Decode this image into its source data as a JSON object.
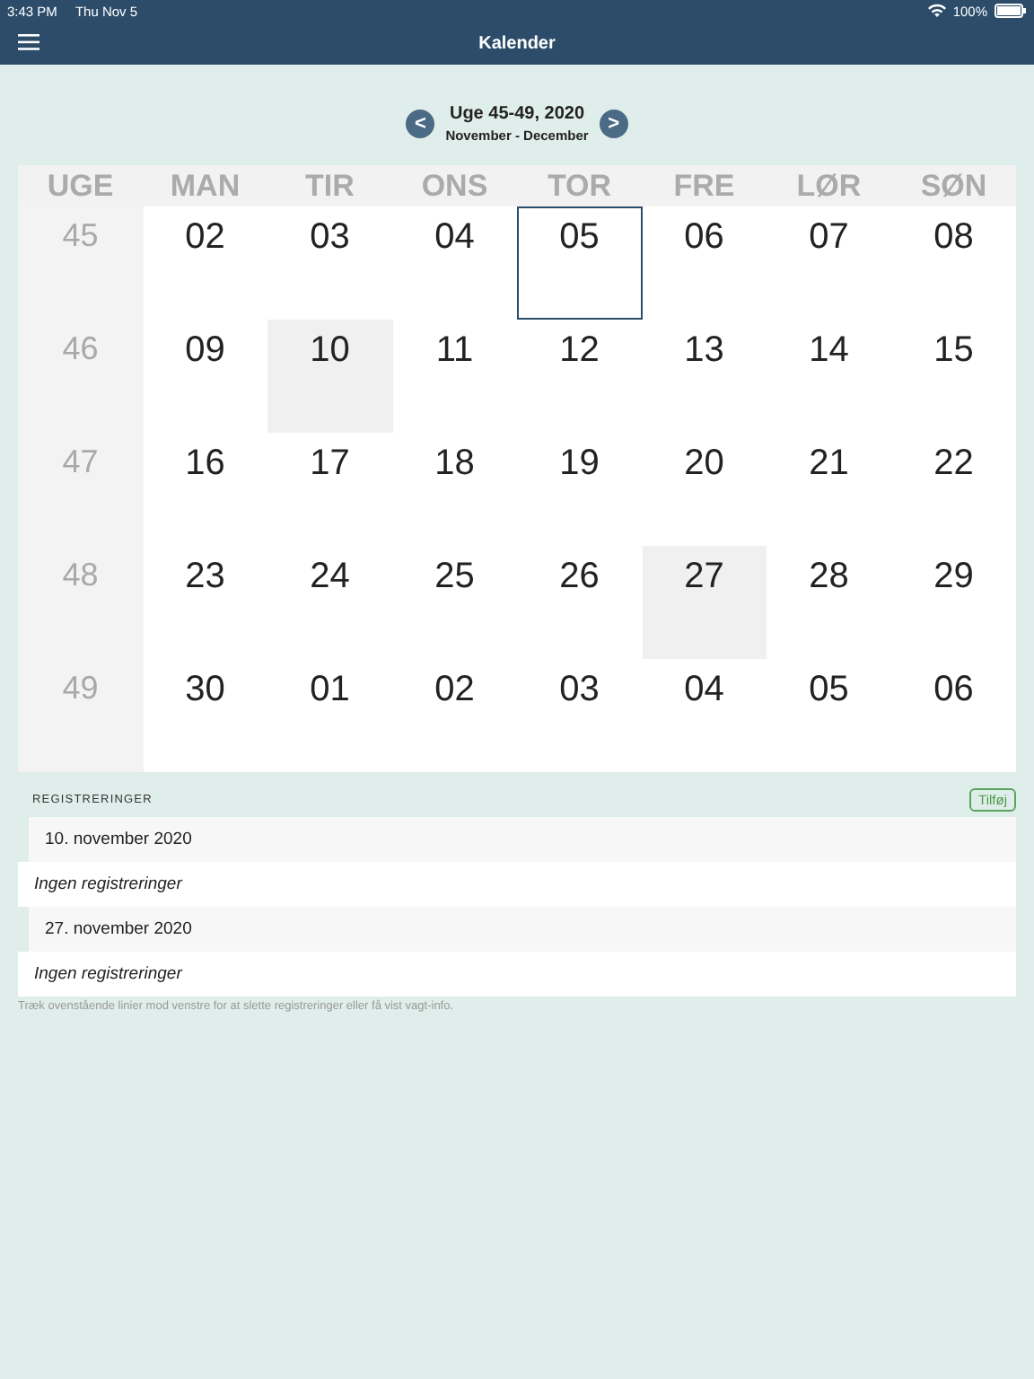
{
  "status_bar": {
    "time": "3:43 PM",
    "date": "Thu Nov 5",
    "battery": "100%"
  },
  "nav_bar": {
    "title": "Kalender"
  },
  "week_nav": {
    "prev": "<",
    "next": ">",
    "title": "Uge 45-49, 2020",
    "subtitle": "November - December"
  },
  "calendar": {
    "columns": [
      "UGE",
      "MAN",
      "TIR",
      "ONS",
      "TOR",
      "FRE",
      "LØR",
      "SØN"
    ],
    "weeks": [
      {
        "week": "45",
        "days": [
          {
            "day": "02",
            "selected": false,
            "today": false
          },
          {
            "day": "03",
            "selected": false,
            "today": false
          },
          {
            "day": "04",
            "selected": false,
            "today": false
          },
          {
            "day": "05",
            "selected": false,
            "today": true
          },
          {
            "day": "06",
            "selected": false,
            "today": false
          },
          {
            "day": "07",
            "selected": false,
            "today": false
          },
          {
            "day": "08",
            "selected": false,
            "today": false
          }
        ]
      },
      {
        "week": "46",
        "days": [
          {
            "day": "09",
            "selected": false,
            "today": false
          },
          {
            "day": "10",
            "selected": true,
            "today": false
          },
          {
            "day": "11",
            "selected": false,
            "today": false
          },
          {
            "day": "12",
            "selected": false,
            "today": false
          },
          {
            "day": "13",
            "selected": false,
            "today": false
          },
          {
            "day": "14",
            "selected": false,
            "today": false
          },
          {
            "day": "15",
            "selected": false,
            "today": false
          }
        ]
      },
      {
        "week": "47",
        "days": [
          {
            "day": "16",
            "selected": false,
            "today": false
          },
          {
            "day": "17",
            "selected": false,
            "today": false
          },
          {
            "day": "18",
            "selected": false,
            "today": false
          },
          {
            "day": "19",
            "selected": false,
            "today": false
          },
          {
            "day": "20",
            "selected": false,
            "today": false
          },
          {
            "day": "21",
            "selected": false,
            "today": false
          },
          {
            "day": "22",
            "selected": false,
            "today": false
          }
        ]
      },
      {
        "week": "48",
        "days": [
          {
            "day": "23",
            "selected": false,
            "today": false
          },
          {
            "day": "24",
            "selected": false,
            "today": false
          },
          {
            "day": "25",
            "selected": false,
            "today": false
          },
          {
            "day": "26",
            "selected": false,
            "today": false
          },
          {
            "day": "27",
            "selected": true,
            "today": false
          },
          {
            "day": "28",
            "selected": false,
            "today": false
          },
          {
            "day": "29",
            "selected": false,
            "today": false
          }
        ]
      },
      {
        "week": "49",
        "days": [
          {
            "day": "30",
            "selected": false,
            "today": false
          },
          {
            "day": "01",
            "selected": false,
            "today": false
          },
          {
            "day": "02",
            "selected": false,
            "today": false
          },
          {
            "day": "03",
            "selected": false,
            "today": false
          },
          {
            "day": "04",
            "selected": false,
            "today": false
          },
          {
            "day": "05",
            "selected": false,
            "today": false
          },
          {
            "day": "06",
            "selected": false,
            "today": false
          }
        ]
      }
    ]
  },
  "registrations": {
    "header": "REGISTRERINGER",
    "add_button": "Tilføj",
    "rows": [
      {
        "kind": "date",
        "text": "10. november 2020"
      },
      {
        "kind": "empty",
        "text": "Ingen registreringer"
      },
      {
        "kind": "date",
        "text": "27. november 2020"
      },
      {
        "kind": "empty",
        "text": "Ingen registreringer"
      }
    ],
    "footer": "Træk ovenstående linier mod venstre for at slette registreringer eller få vist vagt-info."
  }
}
